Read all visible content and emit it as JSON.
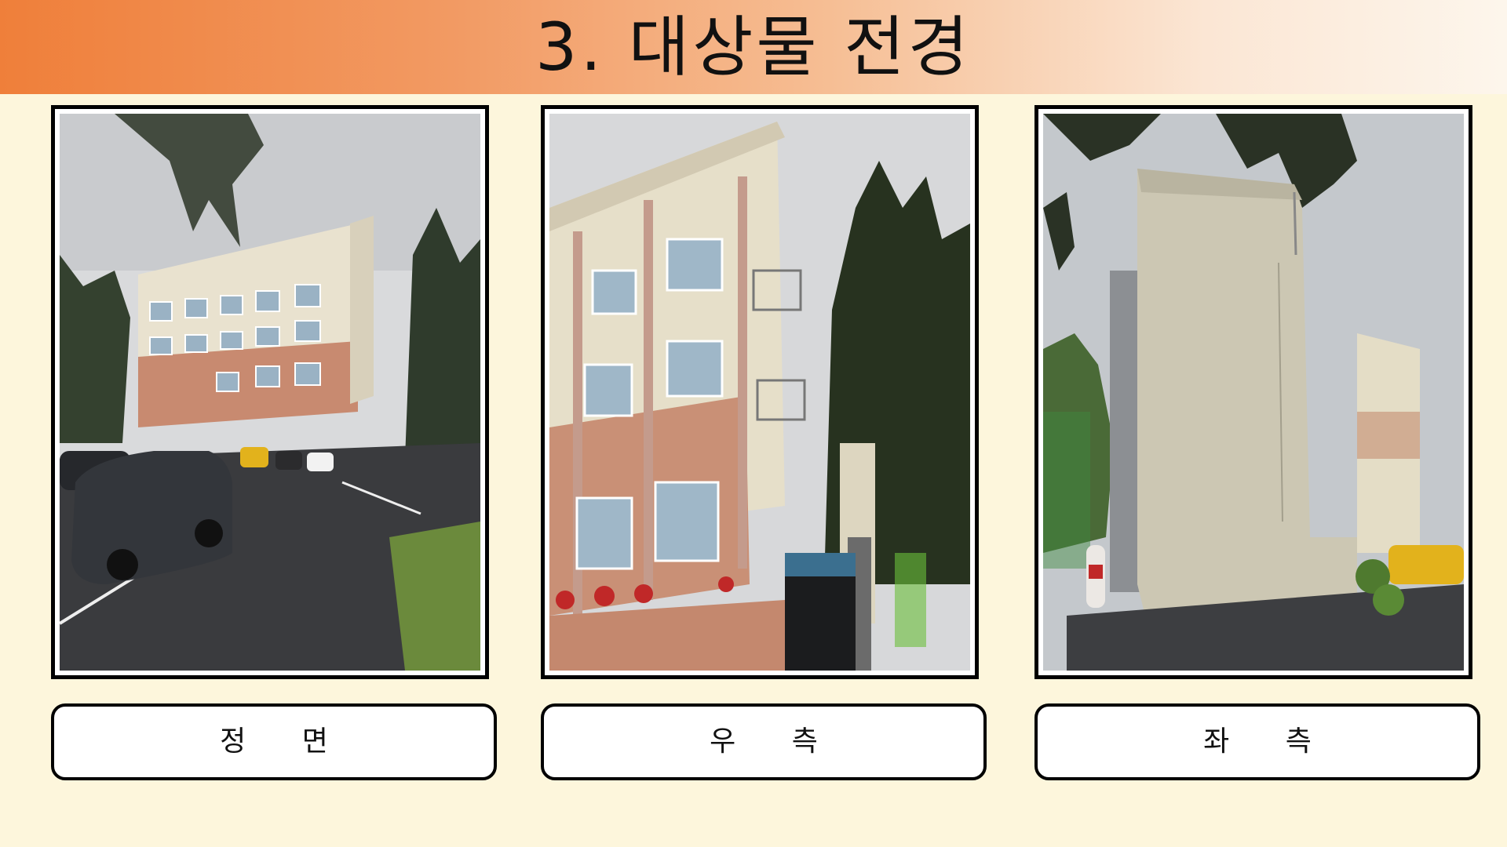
{
  "header": {
    "title": "3. 대상물 전경",
    "gradient_start": "#ef7f3a",
    "gradient_end": "#fdf6ec"
  },
  "background_color": "#fdf6dc",
  "panels": [
    {
      "caption": "정 면",
      "photo": "building-front-photo"
    },
    {
      "caption": "우 측",
      "photo": "building-right-side-photo"
    },
    {
      "caption": "좌 측",
      "photo": "building-left-side-photo"
    }
  ]
}
